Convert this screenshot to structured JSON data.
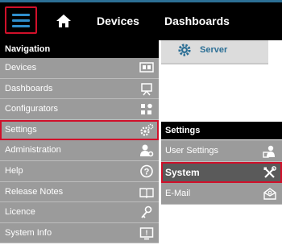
{
  "topbar": {
    "menu_icon": "hamburger-icon",
    "home_icon": "home-icon",
    "items": [
      "Devices",
      "Dashboards"
    ]
  },
  "navigation": {
    "header": "Navigation",
    "items": [
      {
        "label": "Devices",
        "icon": "devices-icon"
      },
      {
        "label": "Dashboards",
        "icon": "dashboard-easel-icon"
      },
      {
        "label": "Configurators",
        "icon": "configurators-icon"
      },
      {
        "label": "Settings",
        "icon": "gears-icon",
        "selected": true
      },
      {
        "label": "Administration",
        "icon": "admin-user-gear-icon"
      },
      {
        "label": "Help",
        "icon": "help-icon"
      },
      {
        "label": "Release Notes",
        "icon": "book-icon"
      },
      {
        "label": "Licence",
        "icon": "key-icon"
      },
      {
        "label": "System Info",
        "icon": "system-info-icon"
      }
    ]
  },
  "server_panel": {
    "label": "Server",
    "icon": "gear-icon"
  },
  "settings_submenu": {
    "header": "Settings",
    "items": [
      {
        "label": "User Settings",
        "icon": "user-settings-icon"
      },
      {
        "label": "System",
        "icon": "tools-icon",
        "active": true
      },
      {
        "label": "E-Mail",
        "icon": "email-icon"
      }
    ]
  },
  "colors": {
    "accent_red": "#d0102a",
    "accent_blue": "#2c6f95",
    "menu_gray": "#9b9b9b",
    "active_gray": "#5a5a5a"
  }
}
